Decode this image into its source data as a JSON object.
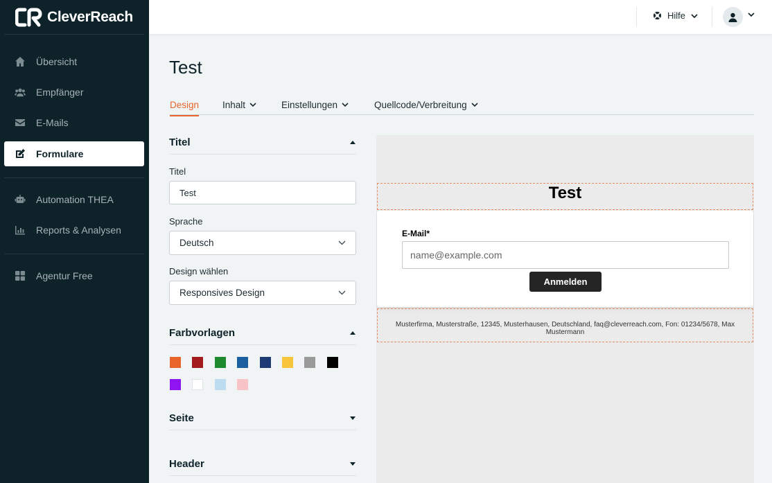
{
  "brand": {
    "name": "CleverReach",
    "accent": "#e8642b",
    "sidebar_bg": "#0d2229"
  },
  "sidebar": {
    "items": [
      {
        "label": "Übersicht",
        "icon": "home-icon"
      },
      {
        "label": "Empfänger",
        "icon": "users-icon"
      },
      {
        "label": "E-Mails",
        "icon": "envelope-icon"
      },
      {
        "label": "Formulare",
        "icon": "edit-icon",
        "active": true
      },
      {
        "label": "Automation THEA",
        "icon": "robot-icon"
      },
      {
        "label": "Reports & Analysen",
        "icon": "bar-chart-icon"
      },
      {
        "label": "Agentur Free",
        "icon": "grid-icon"
      }
    ]
  },
  "topbar": {
    "help_label": "Hilfe"
  },
  "page": {
    "title": "Test",
    "tabs": [
      {
        "label": "Design",
        "active": true
      },
      {
        "label": "Inhalt"
      },
      {
        "label": "Einstellungen"
      },
      {
        "label": "Quellcode/Verbreitung"
      }
    ]
  },
  "settings": {
    "titel_section": "Titel",
    "titel_label": "Titel",
    "titel_value": "Test",
    "sprache_label": "Sprache",
    "sprache_value": "Deutsch",
    "design_label": "Design wählen",
    "design_value": "Responsives Design",
    "farbvorlagen_section": "Farbvorlagen",
    "swatches": [
      "#e8642b",
      "#a31a1f",
      "#1e8a2e",
      "#1b5fa0",
      "#1c3a73",
      "#f8c53d",
      "#9a9a9a",
      "#000000",
      "#8f14f2",
      "#ffffff",
      "#bcdcf0",
      "#f7c3c6"
    ],
    "seite_section": "Seite",
    "header_section": "Header"
  },
  "preview": {
    "title": "Test",
    "email_label": "E-Mail*",
    "email_placeholder": "name@example.com",
    "submit_label": "Anmelden",
    "footer_text": "Musterfirma, Musterstraße, 12345, Musterhausen, Deutschland, faq@cleverreach.com, Fon: 01234/5678, Max Mustermann"
  }
}
